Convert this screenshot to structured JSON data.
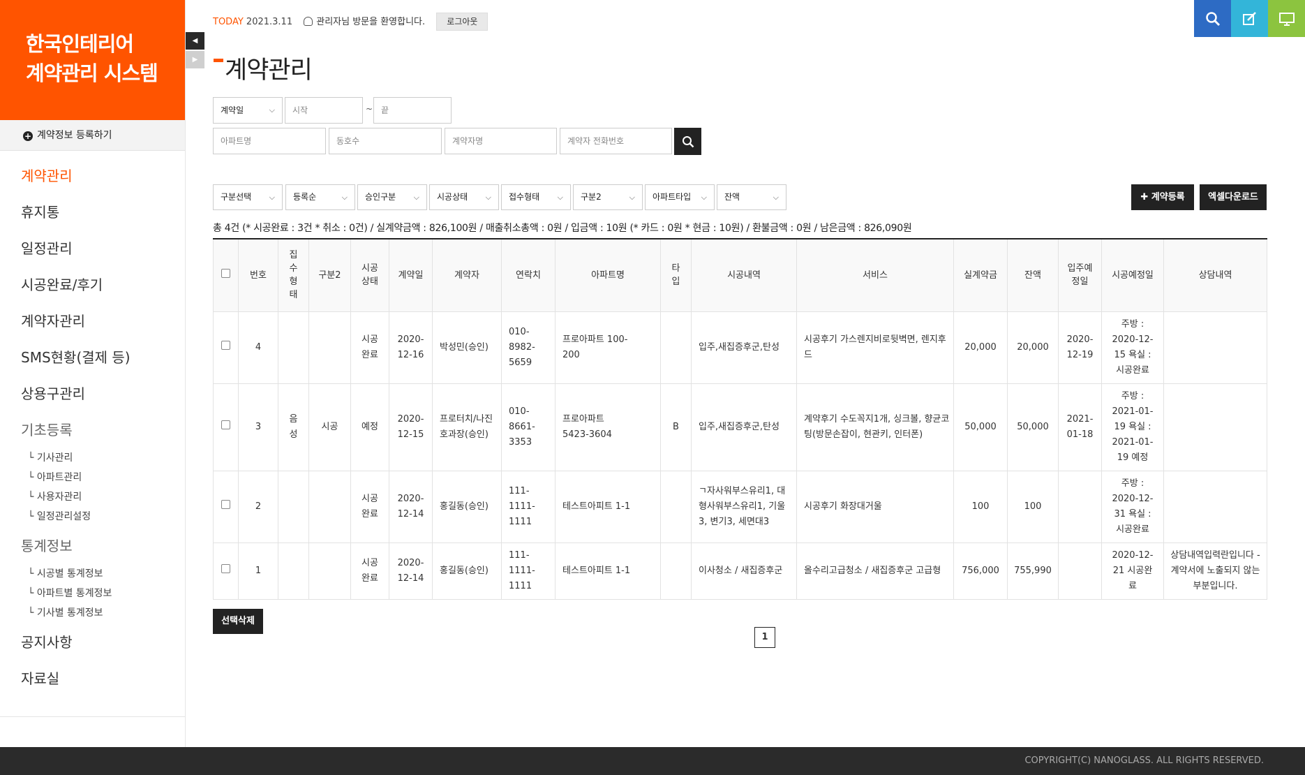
{
  "sidebar": {
    "logo_line1": "한국인테리어",
    "logo_line2": "계약관리 시스템",
    "register_label": "계약정보 등록하기",
    "menu": [
      "계약관리",
      "휴지통",
      "일정관리",
      "시공완료/후기",
      "계약자관리",
      "SMS현황(결제 등)",
      "상용구관리"
    ],
    "basic_label": "기초등록",
    "basic_sub": [
      "└ 기사관리",
      "└ 아파트관리",
      "└ 사용자관리",
      "└ 일정관리설정"
    ],
    "stats_label": "통계정보",
    "stats_sub": [
      "└ 시공별 통계정보",
      "└ 아파트별 통계정보",
      "└ 기사별 통계정보"
    ],
    "notice_label": "공지사항",
    "archive_label": "자료실"
  },
  "topbar": {
    "today_label": "TODAY",
    "date": "2021.3.11",
    "welcome": "관리자님 방문을 환영합니다.",
    "logout": "로그아웃"
  },
  "top_icons": [
    "search-icon",
    "edit-icon",
    "monitor-icon"
  ],
  "colors": {
    "accent": "#ff5400",
    "search_btn": "#2d6bc4",
    "edit_btn": "#33b5d9",
    "monitor_btn": "#8cc43f",
    "dark": "#222222"
  },
  "page_title": "계약관리",
  "search": {
    "date_type": "계약일",
    "start_placeholder": "시작",
    "tilde": "~",
    "end_placeholder": "끝",
    "apt_placeholder": "아파트명",
    "unit_placeholder": "동호수",
    "contractor_placeholder": "계약자명",
    "phone_placeholder": "계약자 전화번호"
  },
  "filters": [
    "구분선택",
    "등록순",
    "승인구분",
    "시공상태",
    "접수형태",
    "구분2",
    "아파트타입",
    "잔액"
  ],
  "buttons": {
    "register": "계약등록",
    "excel": "엑셀다운로드",
    "delete_selected": "선택삭제"
  },
  "summary": "총 4건 (* 시공완료 : 3건 * 취소 : 0건) / 실계약금액 : 826,100원 / 매출취소총액 : 0원 / 입금액 : 10원 (* 카드 : 0원 * 현금 : 10원) / 환불금액 : 0원 / 남은금액 : 826,090원",
  "table": {
    "headers": [
      "번호",
      "집수형태",
      "구분2",
      "시공상태",
      "계약일",
      "계약자",
      "연락치",
      "아파트명",
      "타입",
      "시공내역",
      "서비스",
      "실계약금",
      "잔액",
      "입주예정일",
      "시공예정일",
      "상담내역"
    ],
    "rows": [
      {
        "no": "4",
        "recv": "",
        "div2": "",
        "status": "시공완료",
        "date": "2020-12-16",
        "contractor": "박성민(승인)",
        "phone": "010-8982-5659",
        "apt": "프로아파트 100-200",
        "type": "",
        "work": "입주,새집증후군,탄성",
        "service": "시공후기 가스렌지비로뒷벽면, 렌지후드",
        "amount": "20,000",
        "balance": "20,000",
        "movein": "2020-12-19",
        "schedule": "주방 : 2020-12-15 욕실 : 시공완료",
        "consult": ""
      },
      {
        "no": "3",
        "recv": "음성",
        "div2": "시공",
        "status": "예정",
        "date": "2020-12-15",
        "contractor": "프로터치/나진호과장(승인)",
        "phone": "010-8661-3353",
        "apt": "프로아파트 5423-3604",
        "type": "B",
        "work": "입주,새집증후군,탄성",
        "service": "계약후기 수도꼭지1개, 싱크볼, 향균코팅(방문손잡이, 현관키, 인터폰)",
        "amount": "50,000",
        "balance": "50,000",
        "movein": "2021-01-18",
        "schedule": "주방 : 2021-01-19 욕실 : 2021-01-19 예정",
        "consult": ""
      },
      {
        "no": "2",
        "recv": "",
        "div2": "",
        "status": "시공완료",
        "date": "2020-12-14",
        "contractor": "홍길동(승인)",
        "phone": "111-1111-1111",
        "apt": "테스트아피트 1-1",
        "type": "",
        "work": "ㄱ자사워부스유리1, 대형사워부스유리1, 기울3, 변기3, 세면대3",
        "service": "시공후기 화장대거울",
        "amount": "100",
        "balance": "100",
        "movein": "",
        "schedule": "주방 : 2020-12-31 욕실 : 시공완료",
        "consult": ""
      },
      {
        "no": "1",
        "recv": "",
        "div2": "",
        "status": "시공완료",
        "date": "2020-12-14",
        "contractor": "홍길동(승인)",
        "phone": "111-1111-1111",
        "apt": "테스트아피트 1-1",
        "type": "",
        "work": "이사청소 / 새집증후군",
        "service": "올수리고급청소 / 새집증후군 고급형",
        "amount": "756,000",
        "balance": "755,990",
        "movein": "",
        "schedule": "2020-12-21 시공완료",
        "consult": "상담내역입력란입니다 - 계약서에 노출되지 않는 부분입니다."
      }
    ]
  },
  "pagination": {
    "current": "1"
  },
  "footer": "COPYRIGHT(C) NANOGLASS. ALL RIGHTS RESERVED."
}
